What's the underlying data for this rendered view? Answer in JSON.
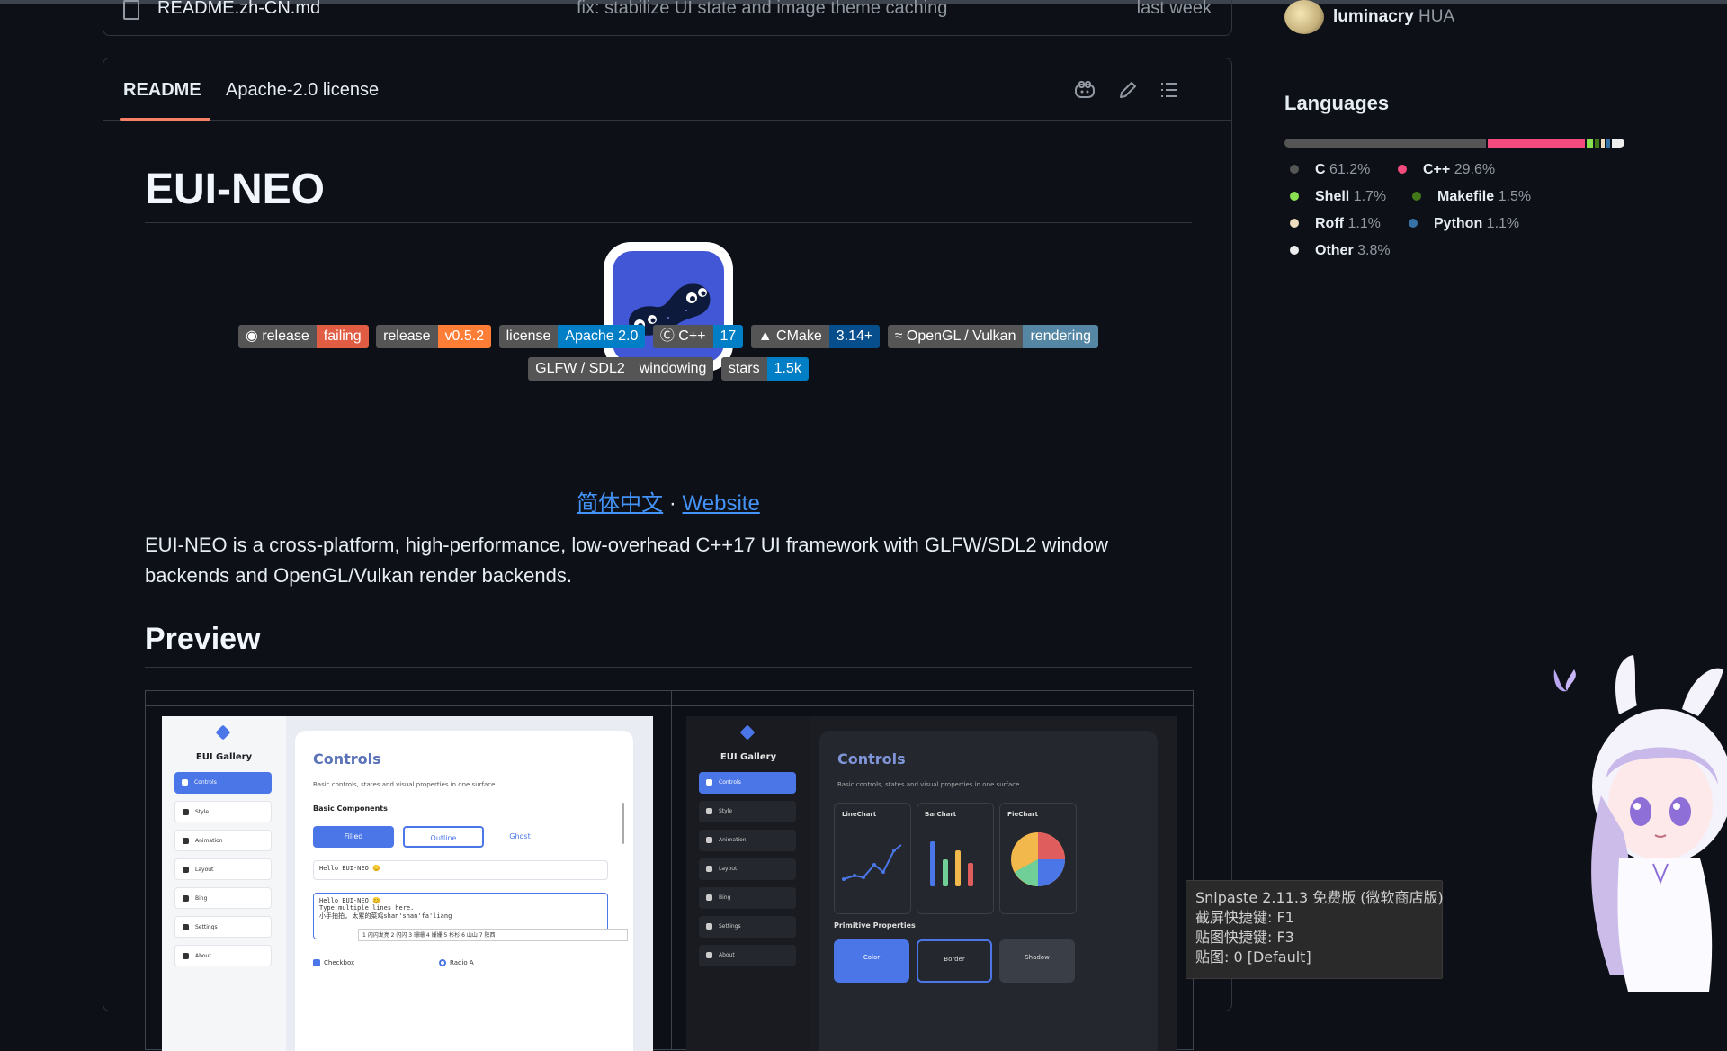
{
  "file_row": {
    "name": "README.zh-CN.md",
    "commit_message": "fix: stabilize UI state and image theme caching",
    "date": "last week"
  },
  "readme": {
    "tabs": [
      "README",
      "Apache-2.0 license"
    ],
    "title": "EUI-NEO",
    "badges_row1": [
      {
        "label": "release",
        "value": "failing",
        "color": "#e05d44",
        "icon": "github-icon"
      },
      {
        "label": "release",
        "value": "v0.5.2",
        "color": "#fe7d37",
        "icon": ""
      },
      {
        "label": "license",
        "value": "Apache 2.0",
        "color": "#007ec6",
        "icon": ""
      },
      {
        "label": "C++",
        "value": "17",
        "color": "#007ec6",
        "icon": "cpp-icon"
      },
      {
        "label": "CMake",
        "value": "3.14+",
        "color": "#064f8c",
        "icon": "cmake-icon"
      },
      {
        "label": "OpenGL / Vulkan",
        "value": "rendering",
        "color": "#5586a4",
        "icon": "opengl-icon"
      }
    ],
    "badges_row2": [
      {
        "label": "GLFW / SDL2",
        "value": "windowing",
        "color": "#555555",
        "icon": ""
      },
      {
        "label": "stars",
        "value": "1.5k",
        "color": "#007ec6",
        "icon": ""
      }
    ],
    "link_cn": "简体中文",
    "link_sep": "·",
    "link_website": "Website",
    "description": "EUI-NEO is a cross-platform, high-performance, low-overhead C++17 UI framework with GLFW/SDL2 window backends and OpenGL/Vulkan render backends.",
    "preview_heading": "Preview"
  },
  "preview": {
    "gallery_title": "EUI Gallery",
    "nav": [
      "Controls",
      "Style",
      "Animation",
      "Layout",
      "Bing",
      "Settings",
      "About"
    ],
    "light": {
      "title": "Controls",
      "subtitle": "Basic controls, states and visual properties in one surface.",
      "section": "Basic Components",
      "buttons": [
        "Filled",
        "Outline",
        "Ghost"
      ],
      "input_single": "Hello EUI-NEO 😊",
      "input_multi": [
        "Hello EUI-NEO 😊",
        "Type multiple lines here.",
        "小手拍拍, 太累的菜鸡shan'shan'fa'liang"
      ],
      "ime": "1 闪闪发亮   2 闪闪   3 珊珊   4 姗姗   5 杉杉   6 山山   7 陕西",
      "checkbox": "Checkbox",
      "radio": "Radio A"
    },
    "dark": {
      "title": "Controls",
      "subtitle": "Basic controls, states and visual properties in one surface.",
      "charts": [
        "LineChart",
        "BarChart",
        "PieChart"
      ],
      "primitive": "Primitive Properties",
      "prim_buttons": [
        "Color",
        "Border",
        "Shadow"
      ]
    }
  },
  "sidebar": {
    "owner_name": "luminacry",
    "owner_alias": "HUA",
    "languages_title": "Languages",
    "languages": [
      {
        "name": "C",
        "pct": "61.2%",
        "color": "#555555",
        "share": 61.2
      },
      {
        "name": "C++",
        "pct": "29.6%",
        "color": "#f34b7d",
        "share": 29.6
      },
      {
        "name": "Shell",
        "pct": "1.7%",
        "color": "#89e051",
        "share": 1.7
      },
      {
        "name": "Makefile",
        "pct": "1.5%",
        "color": "#427819",
        "share": 1.5
      },
      {
        "name": "Roff",
        "pct": "1.1%",
        "color": "#ecdebe",
        "share": 1.1
      },
      {
        "name": "Python",
        "pct": "1.1%",
        "color": "#3572a5",
        "share": 1.1
      },
      {
        "name": "Other",
        "pct": "3.8%",
        "color": "#ededed",
        "share": 3.8
      }
    ]
  },
  "snipaste": {
    "lines": [
      "Snipaste 2.11.3 免费版 (微软商店版)",
      "截屏快捷键: F1",
      "贴图快捷键: F3",
      "贴图: 0 [Default]"
    ]
  }
}
